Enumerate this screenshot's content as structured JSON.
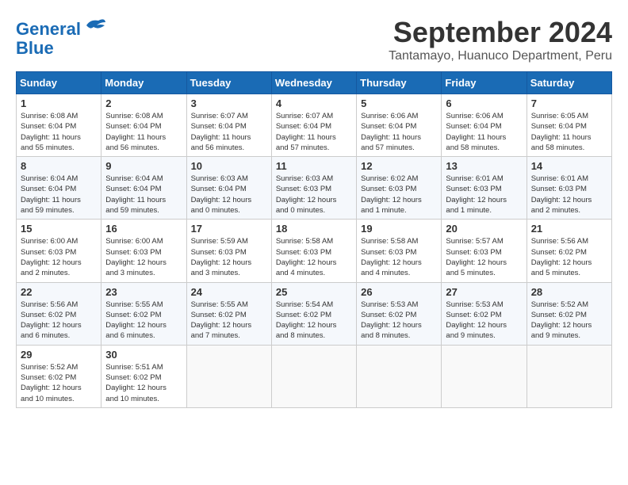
{
  "logo": {
    "line1": "General",
    "line2": "Blue"
  },
  "title": "September 2024",
  "location": "Tantamayo, Huanuco Department, Peru",
  "days_of_week": [
    "Sunday",
    "Monday",
    "Tuesday",
    "Wednesday",
    "Thursday",
    "Friday",
    "Saturday"
  ],
  "weeks": [
    [
      {
        "day": "1",
        "info": "Sunrise: 6:08 AM\nSunset: 6:04 PM\nDaylight: 11 hours\nand 55 minutes."
      },
      {
        "day": "2",
        "info": "Sunrise: 6:08 AM\nSunset: 6:04 PM\nDaylight: 11 hours\nand 56 minutes."
      },
      {
        "day": "3",
        "info": "Sunrise: 6:07 AM\nSunset: 6:04 PM\nDaylight: 11 hours\nand 56 minutes."
      },
      {
        "day": "4",
        "info": "Sunrise: 6:07 AM\nSunset: 6:04 PM\nDaylight: 11 hours\nand 57 minutes."
      },
      {
        "day": "5",
        "info": "Sunrise: 6:06 AM\nSunset: 6:04 PM\nDaylight: 11 hours\nand 57 minutes."
      },
      {
        "day": "6",
        "info": "Sunrise: 6:06 AM\nSunset: 6:04 PM\nDaylight: 11 hours\nand 58 minutes."
      },
      {
        "day": "7",
        "info": "Sunrise: 6:05 AM\nSunset: 6:04 PM\nDaylight: 11 hours\nand 58 minutes."
      }
    ],
    [
      {
        "day": "8",
        "info": "Sunrise: 6:04 AM\nSunset: 6:04 PM\nDaylight: 11 hours\nand 59 minutes."
      },
      {
        "day": "9",
        "info": "Sunrise: 6:04 AM\nSunset: 6:04 PM\nDaylight: 11 hours\nand 59 minutes."
      },
      {
        "day": "10",
        "info": "Sunrise: 6:03 AM\nSunset: 6:04 PM\nDaylight: 12 hours\nand 0 minutes."
      },
      {
        "day": "11",
        "info": "Sunrise: 6:03 AM\nSunset: 6:03 PM\nDaylight: 12 hours\nand 0 minutes."
      },
      {
        "day": "12",
        "info": "Sunrise: 6:02 AM\nSunset: 6:03 PM\nDaylight: 12 hours\nand 1 minute."
      },
      {
        "day": "13",
        "info": "Sunrise: 6:01 AM\nSunset: 6:03 PM\nDaylight: 12 hours\nand 1 minute."
      },
      {
        "day": "14",
        "info": "Sunrise: 6:01 AM\nSunset: 6:03 PM\nDaylight: 12 hours\nand 2 minutes."
      }
    ],
    [
      {
        "day": "15",
        "info": "Sunrise: 6:00 AM\nSunset: 6:03 PM\nDaylight: 12 hours\nand 2 minutes."
      },
      {
        "day": "16",
        "info": "Sunrise: 6:00 AM\nSunset: 6:03 PM\nDaylight: 12 hours\nand 3 minutes."
      },
      {
        "day": "17",
        "info": "Sunrise: 5:59 AM\nSunset: 6:03 PM\nDaylight: 12 hours\nand 3 minutes."
      },
      {
        "day": "18",
        "info": "Sunrise: 5:58 AM\nSunset: 6:03 PM\nDaylight: 12 hours\nand 4 minutes."
      },
      {
        "day": "19",
        "info": "Sunrise: 5:58 AM\nSunset: 6:03 PM\nDaylight: 12 hours\nand 4 minutes."
      },
      {
        "day": "20",
        "info": "Sunrise: 5:57 AM\nSunset: 6:03 PM\nDaylight: 12 hours\nand 5 minutes."
      },
      {
        "day": "21",
        "info": "Sunrise: 5:56 AM\nSunset: 6:02 PM\nDaylight: 12 hours\nand 5 minutes."
      }
    ],
    [
      {
        "day": "22",
        "info": "Sunrise: 5:56 AM\nSunset: 6:02 PM\nDaylight: 12 hours\nand 6 minutes."
      },
      {
        "day": "23",
        "info": "Sunrise: 5:55 AM\nSunset: 6:02 PM\nDaylight: 12 hours\nand 6 minutes."
      },
      {
        "day": "24",
        "info": "Sunrise: 5:55 AM\nSunset: 6:02 PM\nDaylight: 12 hours\nand 7 minutes."
      },
      {
        "day": "25",
        "info": "Sunrise: 5:54 AM\nSunset: 6:02 PM\nDaylight: 12 hours\nand 8 minutes."
      },
      {
        "day": "26",
        "info": "Sunrise: 5:53 AM\nSunset: 6:02 PM\nDaylight: 12 hours\nand 8 minutes."
      },
      {
        "day": "27",
        "info": "Sunrise: 5:53 AM\nSunset: 6:02 PM\nDaylight: 12 hours\nand 9 minutes."
      },
      {
        "day": "28",
        "info": "Sunrise: 5:52 AM\nSunset: 6:02 PM\nDaylight: 12 hours\nand 9 minutes."
      }
    ],
    [
      {
        "day": "29",
        "info": "Sunrise: 5:52 AM\nSunset: 6:02 PM\nDaylight: 12 hours\nand 10 minutes."
      },
      {
        "day": "30",
        "info": "Sunrise: 5:51 AM\nSunset: 6:02 PM\nDaylight: 12 hours\nand 10 minutes."
      },
      {
        "day": "",
        "info": ""
      },
      {
        "day": "",
        "info": ""
      },
      {
        "day": "",
        "info": ""
      },
      {
        "day": "",
        "info": ""
      },
      {
        "day": "",
        "info": ""
      }
    ]
  ]
}
